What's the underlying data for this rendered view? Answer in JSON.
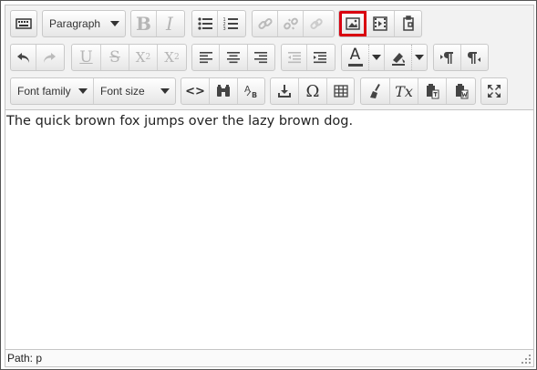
{
  "toolbar": {
    "row1": {
      "toolbar_toggle_icon": "keyboard-icon",
      "format_select": "Paragraph",
      "bold": "B",
      "italic": "I",
      "bullet_list_icon": "bullet-list-icon",
      "numbered_list_icon": "numbered-list-icon",
      "link_icon": "link-icon",
      "unlink_icon": "unlink-icon",
      "anchor_icon": "anchor-icon",
      "image_icon": "image-icon",
      "media_icon": "media-icon",
      "paste_icon": "paste-icon"
    },
    "row2": {
      "underline": "U",
      "strikethrough": "S",
      "subscript": "X",
      "subscript_mark": "2",
      "superscript": "X",
      "superscript_mark": "2",
      "text_color_letter": "A"
    },
    "row3": {
      "font_family_select": "Font family",
      "font_size_select": "Font size",
      "code_label": "<>",
      "clear_format_label": "Tx"
    }
  },
  "content": {
    "text": "The quick brown fox jumps over the lazy brown dog."
  },
  "status": {
    "path": "Path: p"
  },
  "colors": {
    "highlight": "#d9000f",
    "toolbar_bg": "#f2f2f2",
    "border": "#c5c5c5"
  }
}
